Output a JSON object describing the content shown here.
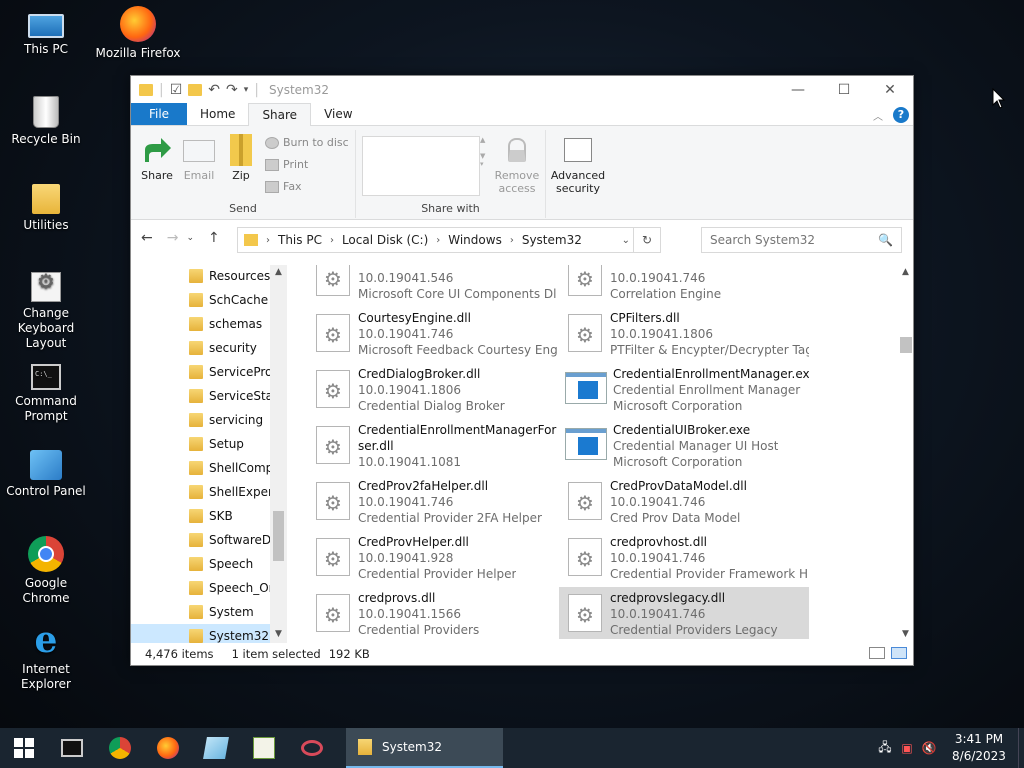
{
  "desktop": {
    "icons": [
      {
        "label": "This PC"
      },
      {
        "label": "Mozilla Firefox"
      },
      {
        "label": "Recycle Bin"
      },
      {
        "label": "Utilities"
      },
      {
        "label": "Change Keyboard Layout"
      },
      {
        "label": "Command Prompt"
      },
      {
        "label": "Control Panel"
      },
      {
        "label": "Google Chrome"
      },
      {
        "label": "Internet Explorer"
      }
    ]
  },
  "window": {
    "title": "System32",
    "tabs": {
      "file": "File",
      "home": "Home",
      "share": "Share",
      "view": "View"
    },
    "ribbon": {
      "send": {
        "share": "Share",
        "email": "Email",
        "zip": "Zip",
        "burn": "Burn to disc",
        "print": "Print",
        "fax": "Fax",
        "group": "Send"
      },
      "share_with": {
        "remove_access": "Remove access",
        "group": "Share with"
      },
      "advanced_security": "Advanced security"
    },
    "address": {
      "crumbs": [
        "This PC",
        "Local Disk (C:)",
        "Windows",
        "System32"
      ]
    },
    "search": {
      "placeholder": "Search System32"
    },
    "tree": [
      "Resources",
      "SchCache",
      "schemas",
      "security",
      "ServiceProfi",
      "ServiceState",
      "servicing",
      "Setup",
      "ShellCompo",
      "ShellExperie",
      "SKB",
      "SoftwareDis",
      "Speech",
      "Speech_One",
      "System",
      "System32"
    ],
    "files": [
      {
        "name": "",
        "line2": "10.0.19041.546",
        "line3": "Microsoft Core UI Components Dll",
        "icon": "dll"
      },
      {
        "name": "",
        "line2": "10.0.19041.746",
        "line3": "Correlation Engine",
        "icon": "dll"
      },
      {
        "name": "CourtesyEngine.dll",
        "line2": "10.0.19041.746",
        "line3": "Microsoft Feedback Courtesy Eng...",
        "icon": "dll"
      },
      {
        "name": "CPFilters.dll",
        "line2": "10.0.19041.1806",
        "line3": "PTFilter & Encypter/Decrypter Tag...",
        "icon": "dll"
      },
      {
        "name": "CredDialogBroker.dll",
        "line2": "10.0.19041.1806",
        "line3": "Credential Dialog Broker",
        "icon": "dll"
      },
      {
        "name": "CredentialEnrollmentManager.exe",
        "line2": "Credential Enrollment Manager",
        "line3": "Microsoft Corporation",
        "icon": "exe"
      },
      {
        "name": "CredentialEnrollmentManagerForU",
        "name2": "ser.dll",
        "line2": "10.0.19041.1081",
        "line3": "",
        "icon": "dll"
      },
      {
        "name": "CredentialUIBroker.exe",
        "line2": "Credential Manager UI Host",
        "line3": "Microsoft Corporation",
        "icon": "exe"
      },
      {
        "name": "CredProv2faHelper.dll",
        "line2": "10.0.19041.746",
        "line3": "Credential Provider 2FA Helper",
        "icon": "dll"
      },
      {
        "name": "CredProvDataModel.dll",
        "line2": "10.0.19041.746",
        "line3": "Cred Prov Data Model",
        "icon": "dll"
      },
      {
        "name": "CredProvHelper.dll",
        "line2": "10.0.19041.928",
        "line3": "Credential Provider Helper",
        "icon": "dll"
      },
      {
        "name": "credprovhost.dll",
        "line2": "10.0.19041.746",
        "line3": "Credential Provider Framework H...",
        "icon": "dll"
      },
      {
        "name": "credprovs.dll",
        "line2": "10.0.19041.1566",
        "line3": "Credential Providers",
        "icon": "dll"
      },
      {
        "name": "credprovslegacy.dll",
        "line2": "10.0.19041.746",
        "line3": "Credential Providers Legacy",
        "icon": "dll",
        "selected": true
      }
    ],
    "status": {
      "items": "4,476 items",
      "selected": "1 item selected",
      "size": "192 KB"
    }
  },
  "taskbar": {
    "app": "System32",
    "time": "3:41 PM",
    "date": "8/6/2023"
  }
}
